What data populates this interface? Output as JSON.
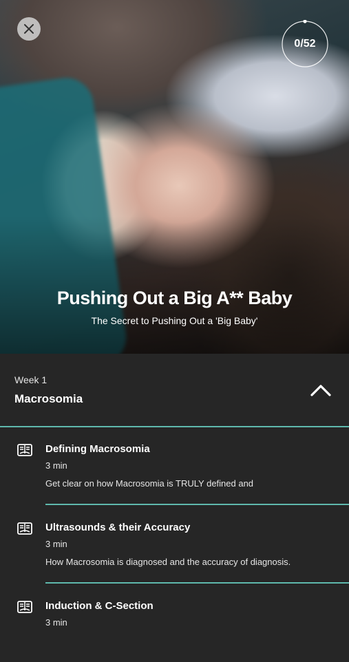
{
  "hero": {
    "title": "Pushing Out a Big  A** Baby",
    "subtitle": "The Secret to Pushing  Out a 'Big Baby'",
    "progress_text": "0/52",
    "progress_value": 0
  },
  "week": {
    "label": "Week 1",
    "title": "Macrosomia"
  },
  "lessons": [
    {
      "title": "Defining Macrosomia",
      "duration": "3 min",
      "description": "Get clear on how Macrosomia is TRULY defined and"
    },
    {
      "title": "Ultrasounds & their Accuracy",
      "duration": "3 min",
      "description": "How Macrosomia is diagnosed and the accuracy of diagnosis."
    },
    {
      "title": "Induction & C-Section",
      "duration": "3 min",
      "description": ""
    }
  ],
  "icons": {
    "close": "close-icon",
    "collapse": "chevron-up-icon",
    "lesson": "book-icon"
  },
  "colors": {
    "background": "#262626",
    "accent": "#5fb9ad"
  }
}
